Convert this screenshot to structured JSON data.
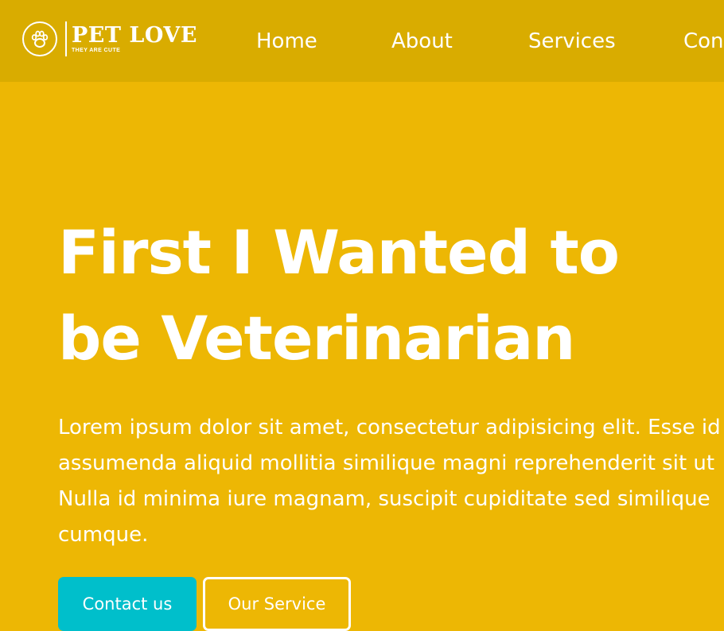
{
  "brand": {
    "name": "PET LOVE",
    "tagline": "They are cute",
    "icon": "paw-icon"
  },
  "nav": {
    "items": [
      {
        "label": "Home"
      },
      {
        "label": "About"
      },
      {
        "label": "Services"
      },
      {
        "label": "Contact"
      }
    ]
  },
  "hero": {
    "title": "First I Wanted to be Veterinarian",
    "text": "Lorem ipsum dolor sit amet, consectetur adipisicing elit. Esse id\nassumenda aliquid mollitia similique magni reprehenderit sit ut\nNulla id minima iure magnam, suscipit cupiditate sed similique\ncumque.",
    "primary_button": "Contact us",
    "secondary_button": "Our Service"
  },
  "colors": {
    "navbar": "#D9AC00",
    "hero_background": "#EDB704",
    "primary_button": "#00BFCB",
    "text": "#FFFFFF"
  }
}
